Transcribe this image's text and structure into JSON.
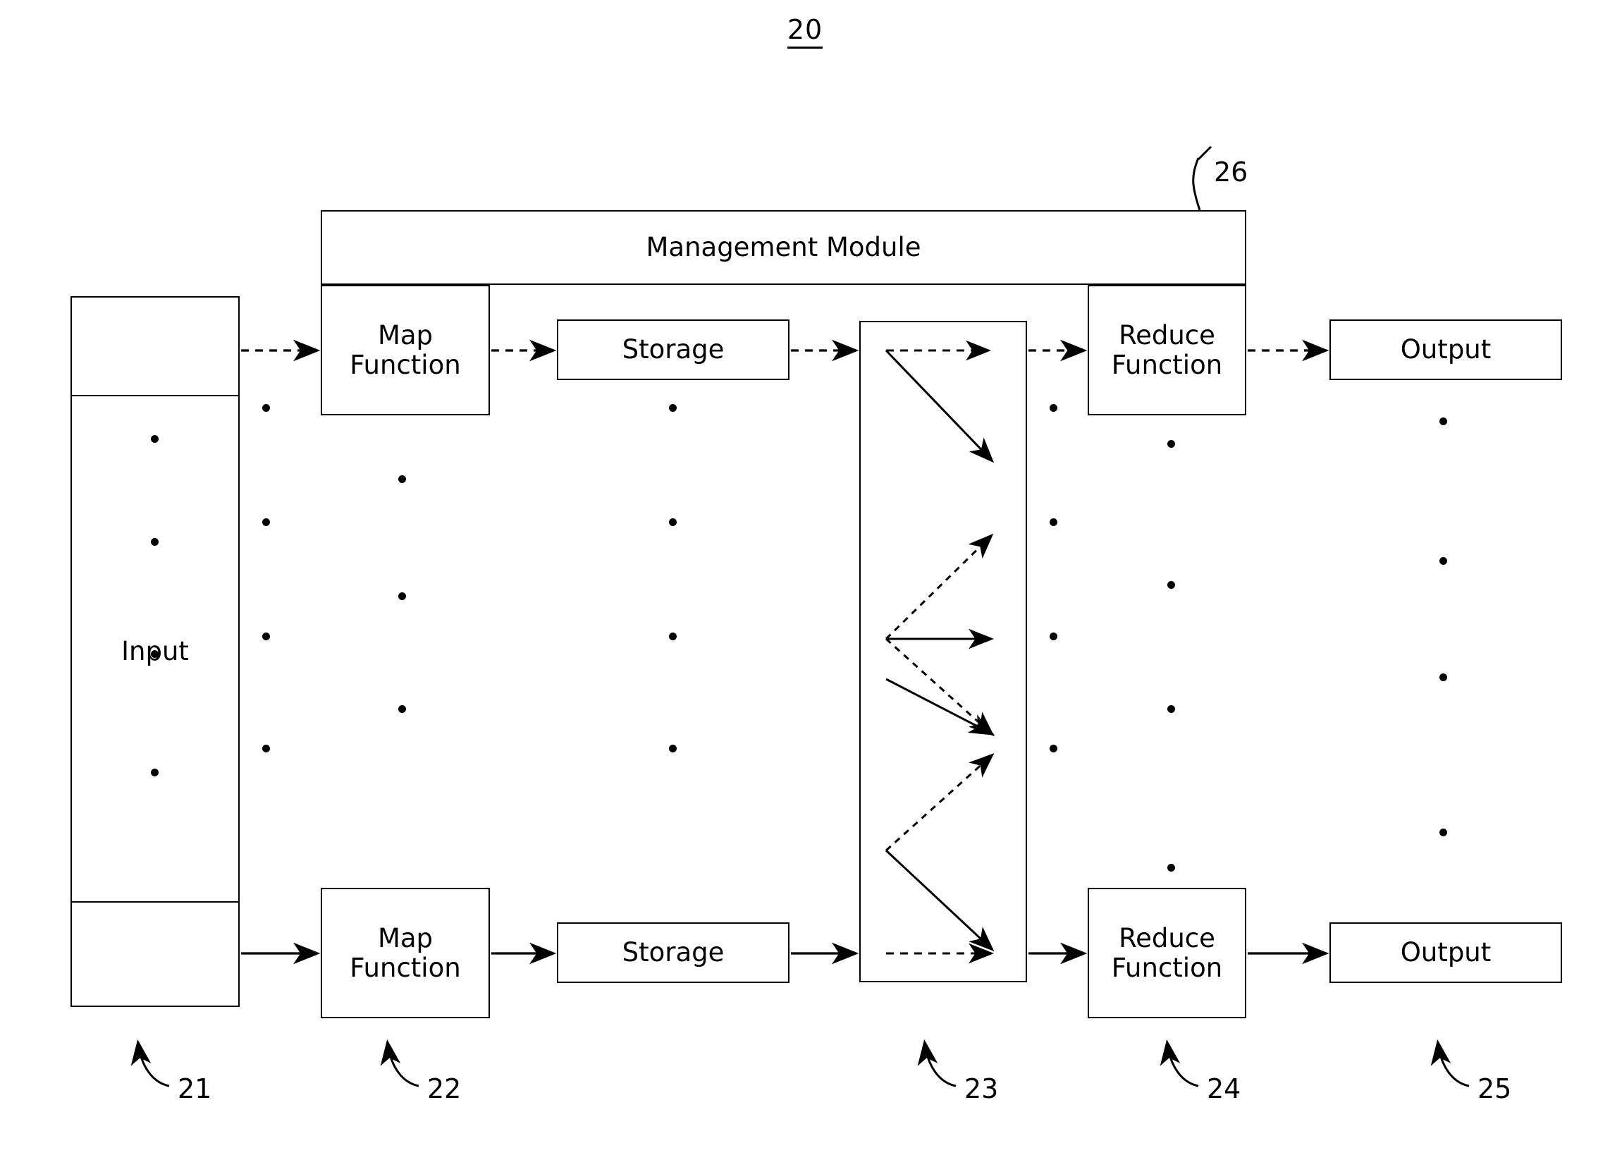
{
  "figure": {
    "number": "20",
    "title_underlined": true
  },
  "colors": {
    "stroke": "#000000",
    "background": "#ffffff"
  },
  "blocks": {
    "management_module": {
      "label": "Management Module",
      "ref": "26"
    },
    "input": {
      "label": "Input",
      "ref": "21"
    },
    "map_top": {
      "label": "Map\nFunction"
    },
    "map_bottom": {
      "label": "Map\nFunction",
      "ref": "22"
    },
    "storage_top": {
      "label": "Storage"
    },
    "storage_bottom": {
      "label": "Storage"
    },
    "shuffle": {
      "label": "",
      "ref": "23"
    },
    "reduce_top": {
      "label": "Reduce\nFunction"
    },
    "reduce_bottom": {
      "label": "Reduce\nFunction",
      "ref": "24"
    },
    "output_top": {
      "label": "Output"
    },
    "output_bottom": {
      "label": "Output",
      "ref": "25"
    }
  },
  "reference_numerals": [
    {
      "id": "ref-21",
      "text": "21"
    },
    {
      "id": "ref-22",
      "text": "22"
    },
    {
      "id": "ref-23",
      "text": "23"
    },
    {
      "id": "ref-24",
      "text": "24"
    },
    {
      "id": "ref-25",
      "text": "25"
    },
    {
      "id": "ref-26",
      "text": "26"
    }
  ],
  "ellipsis_columns": [
    {
      "name": "input-interior-dots",
      "count": 4
    },
    {
      "name": "input-to-map-dots",
      "count": 4
    },
    {
      "name": "map-column-dots",
      "count": 3
    },
    {
      "name": "storage-column-dots",
      "count": 4
    },
    {
      "name": "shuffle-right-dots",
      "count": 4
    },
    {
      "name": "reduce-column-dots",
      "count": 4
    },
    {
      "name": "output-column-dots",
      "count": 4
    }
  ]
}
